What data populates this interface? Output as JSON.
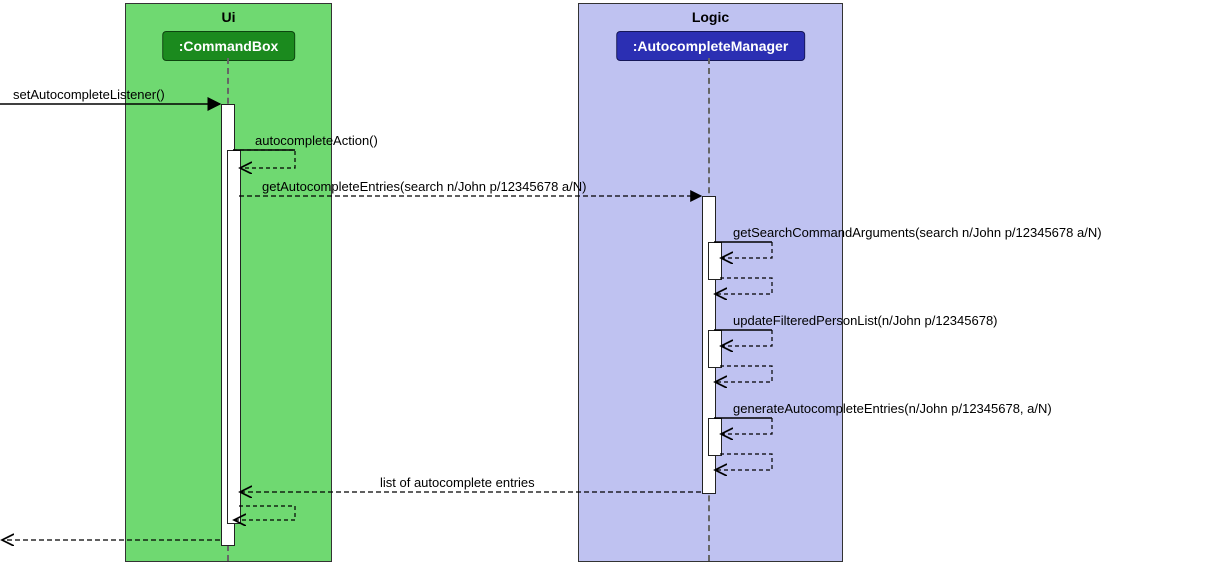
{
  "participants": {
    "ui": {
      "title": "Ui",
      "class": ":CommandBox"
    },
    "logic": {
      "title": "Logic",
      "class": ":AutocompleteManager"
    }
  },
  "messages": {
    "m1": "setAutocompleteListener()",
    "m2": "autocompleteAction()",
    "m3": "getAutocompleteEntries(search n/John p/12345678 a/N)",
    "m4": "getSearchCommandArguments(search n/John p/12345678 a/N)",
    "m5": "updateFilteredPersonList(n/John p/12345678)",
    "m6": "generateAutocompleteEntries(n/John p/12345678, a/N)",
    "r1": "list of autocomplete entries"
  }
}
